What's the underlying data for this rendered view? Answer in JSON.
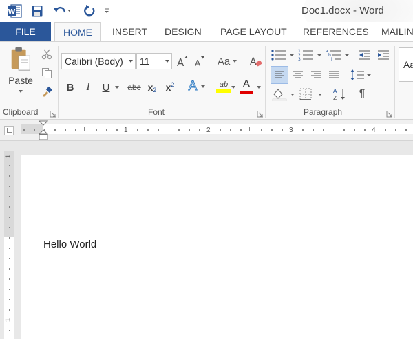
{
  "window": {
    "title": "Doc1.docx - Word"
  },
  "quick_access": {
    "logo": "word-logo-icon",
    "save": "save-icon",
    "undo": "undo-icon",
    "redo": "redo-icon",
    "customize": "customize-qat-icon"
  },
  "tabs": [
    {
      "label": "FILE"
    },
    {
      "label": "HOME"
    },
    {
      "label": "INSERT"
    },
    {
      "label": "DESIGN"
    },
    {
      "label": "PAGE LAYOUT"
    },
    {
      "label": "REFERENCES"
    },
    {
      "label": "MAILIN"
    }
  ],
  "clipboard": {
    "paste_label": "Paste",
    "group_label": "Clipboard"
  },
  "font": {
    "family": "Calibri (Body)",
    "size": "11",
    "change_case_label": "Aa",
    "bold": "B",
    "italic": "I",
    "underline": "U",
    "strikethrough": "abc",
    "subscript": "x",
    "subscript_mark": "2",
    "superscript": "x",
    "superscript_mark": "2",
    "text_effect": "A",
    "highlight": "ab",
    "font_color": "A",
    "highlight_color": "#ffff00",
    "font_color_swatch": "#e00000",
    "group_label": "Font"
  },
  "paragraph": {
    "group_label": "Paragraph",
    "pilcrow": "¶"
  },
  "styles": {
    "preview": "Aa"
  },
  "ruler": {
    "numbers": [
      "1",
      "2",
      "3",
      "4"
    ],
    "vertical_numbers": [
      "1",
      "1"
    ]
  },
  "document": {
    "text": "Hello World"
  },
  "colors": {
    "accent": "#2b579a",
    "icon_blue": "#2b579a"
  }
}
